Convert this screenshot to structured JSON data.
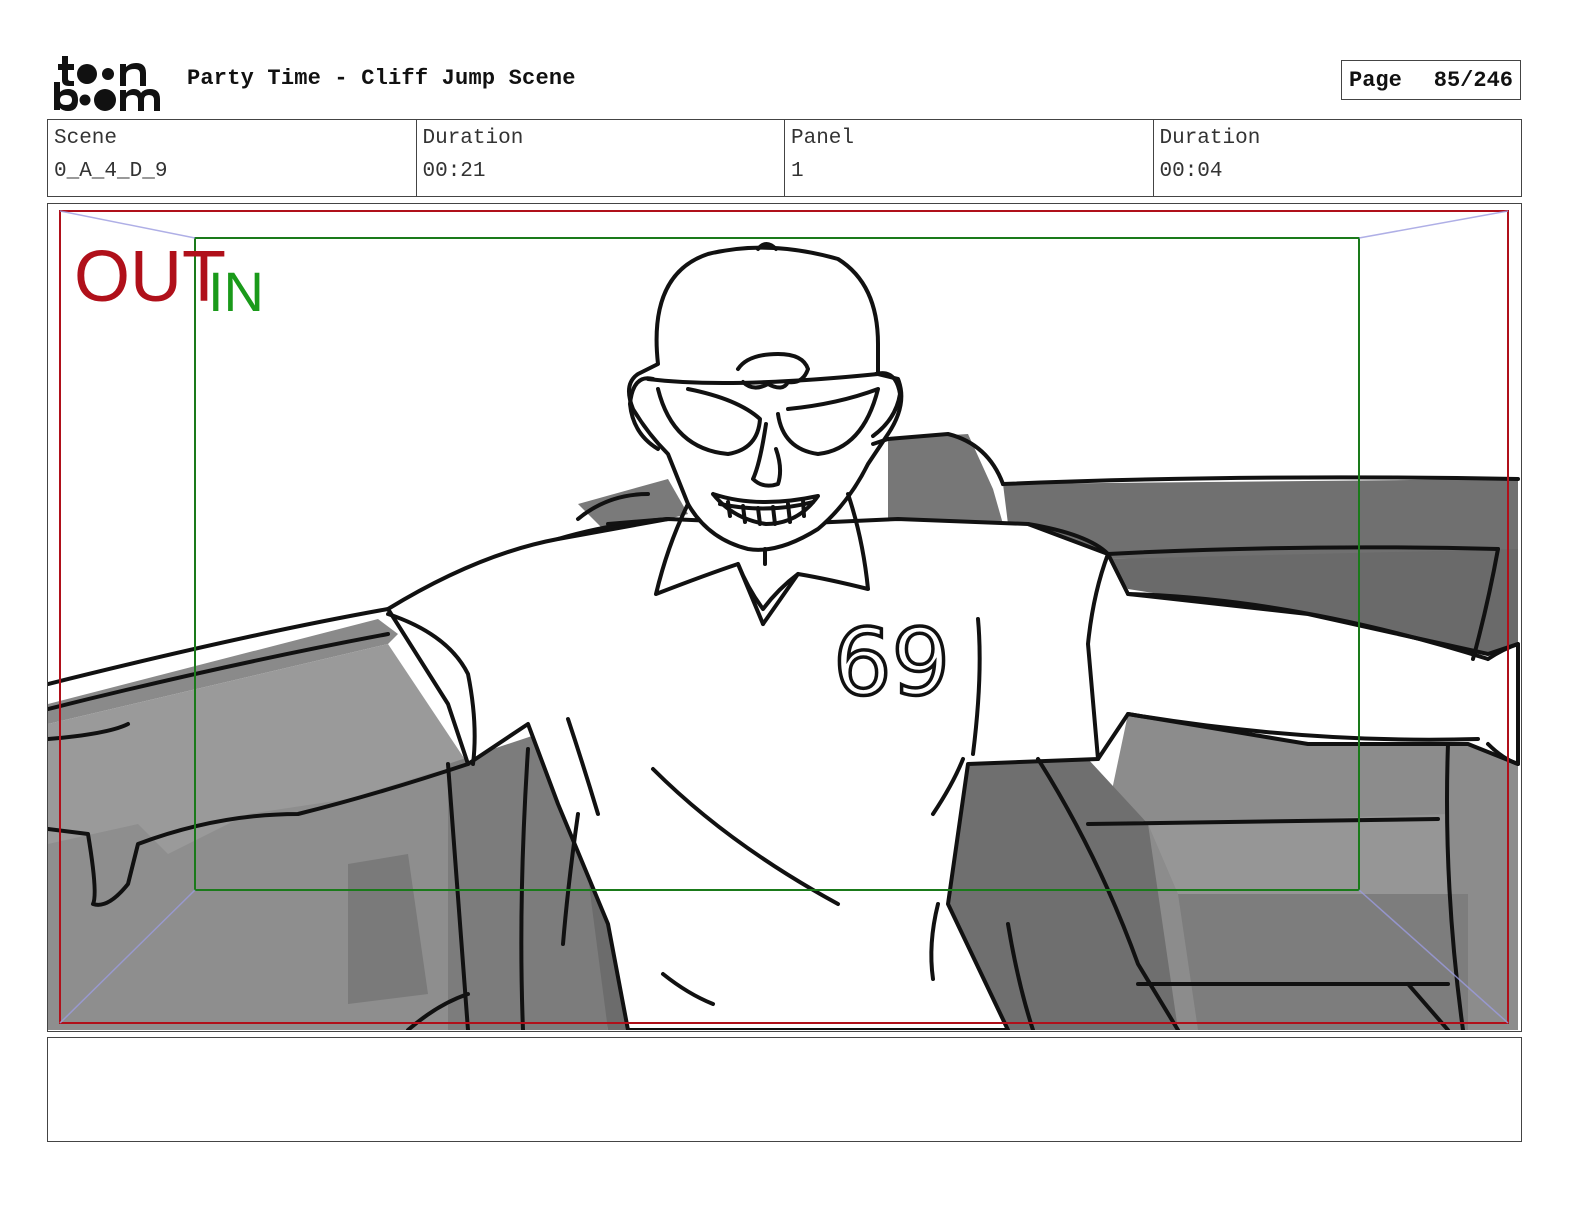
{
  "header": {
    "logo_text": "toon boom",
    "title": "Party Time - Cliff Jump Scene",
    "page_label": "Page",
    "page_value": "85/246"
  },
  "info": [
    {
      "label": "Scene",
      "value": "0_A_4_D_9"
    },
    {
      "label": "Duration",
      "value": "00:21"
    },
    {
      "label": "Panel",
      "value": "1"
    },
    {
      "label": "Duration",
      "value": "00:04"
    }
  ],
  "panel": {
    "out_label": "OUT",
    "in_label": "IN",
    "shirt_number": "69",
    "out_color": "#b0101a",
    "in_color": "#1a9a1a"
  },
  "notes": {
    "text": ""
  }
}
